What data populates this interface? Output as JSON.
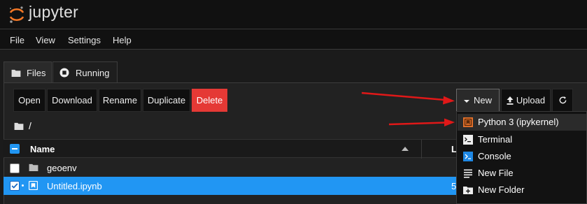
{
  "app": {
    "logo_text": "jupyter"
  },
  "menu": {
    "items": [
      "File",
      "View",
      "Settings",
      "Help"
    ]
  },
  "tabs": [
    {
      "label": "Files",
      "icon": "folder-icon",
      "active": true
    },
    {
      "label": "Running",
      "icon": "stop-circle-icon",
      "active": false
    }
  ],
  "toolbar": {
    "open": "Open",
    "download": "Download",
    "rename": "Rename",
    "duplicate": "Duplicate",
    "delete": "Delete",
    "new": "New",
    "upload": "Upload",
    "refresh_icon": "refresh-icon"
  },
  "breadcrumb": {
    "path": "/"
  },
  "columns": {
    "name": "Name",
    "last_modified": "La"
  },
  "rows": [
    {
      "name": "geoenv",
      "type": "folder",
      "checked": false,
      "last_modified": ""
    },
    {
      "name": "Untitled.ipynb",
      "type": "notebook",
      "checked": true,
      "last_modified": "5"
    }
  ],
  "new_menu": {
    "items": [
      {
        "label": "Python 3 (ipykernel)",
        "icon": "python-kernel-icon",
        "highlighted": true
      },
      {
        "label": "Terminal",
        "icon": "terminal-icon",
        "highlighted": false
      },
      {
        "label": "Console",
        "icon": "console-icon",
        "highlighted": false
      },
      {
        "label": "New File",
        "icon": "file-lines-icon",
        "highlighted": false
      },
      {
        "label": "New Folder",
        "icon": "new-folder-icon",
        "highlighted": false
      }
    ]
  },
  "colors": {
    "accent": "#2196f3",
    "delete": "#e53935",
    "arrow": "#e01818",
    "kernel_icon": "#e8732c",
    "console_icon": "#1e88e5"
  }
}
